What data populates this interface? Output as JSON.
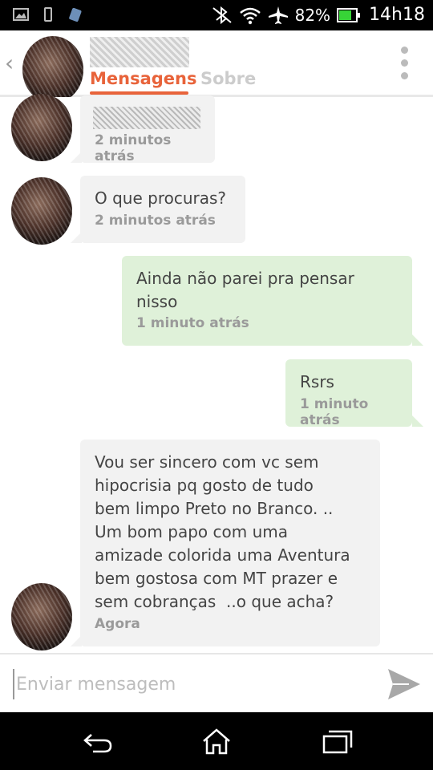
{
  "status_bar": {
    "battery": "82%",
    "battery_fill": 0.82,
    "time": "14h18",
    "left_icons": [
      "gallery-icon",
      "phone-icon",
      "app-icon"
    ],
    "right_icons": [
      "bluetooth-icon",
      "wifi-icon",
      "airplane-icon",
      "battery-icon"
    ]
  },
  "header": {
    "tabs": [
      {
        "label": "Mensagens",
        "active": true
      },
      {
        "label": "Sobre",
        "active": false
      }
    ],
    "accent_color": "#e8633a"
  },
  "messages": [
    {
      "direction": "in",
      "text": "",
      "time": "2 minutos atrás"
    },
    {
      "direction": "in",
      "text": "O que procuras?",
      "time": "2 minutos atrás"
    },
    {
      "direction": "out",
      "text": "Ainda não parei pra pensar\nnisso",
      "time": "1 minuto atrás"
    },
    {
      "direction": "out",
      "text": "Rsrs",
      "time": "1 minuto atrás"
    },
    {
      "direction": "in",
      "text": "Vou ser sincero com vc sem\nhipocrisia pq gosto de tudo\nbem limpo Preto no Branco. ..\nUm bom papo com uma\namizade colorida uma Aventura\nbem gostosa com MT prazer e\nsem cobranças  ..o que acha?",
      "time": "Agora"
    }
  ],
  "composer": {
    "placeholder": "Enviar mensagem"
  },
  "nav": {
    "buttons": [
      "back-icon",
      "home-icon",
      "recent-apps-icon"
    ]
  }
}
